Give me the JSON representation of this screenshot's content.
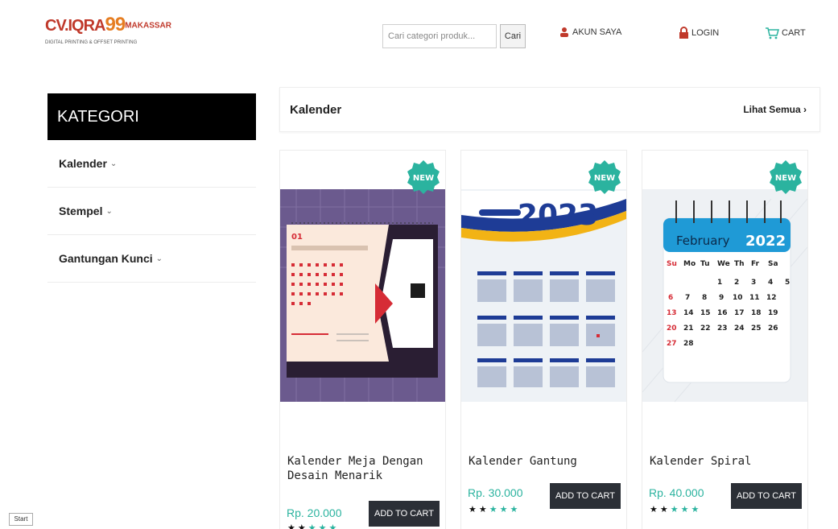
{
  "header": {
    "logo_text_a": "CV.IQRA",
    "logo_text_b": "99",
    "logo_text_c": "MAKASSAR",
    "logo_sub": "DIGITAL PRINTING & OFFSET PRINTING",
    "search_placeholder": "Cari categori produk...",
    "search_button": "Cari",
    "account_label": "AKUN SAYA",
    "login_label": "LOGIN",
    "cart_label": "CART"
  },
  "sidebar": {
    "title": "KATEGORI",
    "items": [
      {
        "label": "Kalender"
      },
      {
        "label": "Stempel"
      },
      {
        "label": "Gantungan Kunci"
      }
    ]
  },
  "section": {
    "title": "Kalender",
    "see_all": "Lihat Semua ›"
  },
  "products": [
    {
      "name": "Kalender Meja Dengan Desain Menarik",
      "price": "Rp. 20.000",
      "button": "ADD TO CART",
      "badge": "NEW",
      "rating": 2
    },
    {
      "name": "Kalender Gantung",
      "price": "Rp. 30.000",
      "button": "ADD TO CART",
      "badge": "NEW",
      "rating": 2,
      "year_label": "2023"
    },
    {
      "name": "Kalender Spiral",
      "price": "Rp. 40.000",
      "button": "ADD TO CART",
      "badge": "NEW",
      "rating": 2,
      "month_label": "February",
      "year_label": "2022",
      "weekdays": [
        "Su",
        "Mo",
        "Tu",
        "We",
        "Th",
        "Fr",
        "Sa"
      ],
      "weeks": [
        [
          "",
          "",
          "",
          "1",
          "2",
          "3",
          "4",
          "5"
        ],
        [
          "6",
          "7",
          "8",
          "9",
          "10",
          "11",
          "12"
        ],
        [
          "13",
          "14",
          "15",
          "16",
          "17",
          "18",
          "19"
        ],
        [
          "20",
          "21",
          "22",
          "23",
          "24",
          "25",
          "26"
        ],
        [
          "27",
          "28",
          "",
          "",
          "",
          "",
          ""
        ]
      ]
    }
  ],
  "taskbar": {
    "start": "Start"
  },
  "colors": {
    "accent": "#2bb39f",
    "button_dark": "#2b2f36",
    "brand_red": "#c0392b",
    "brand_orange": "#e67e22"
  }
}
